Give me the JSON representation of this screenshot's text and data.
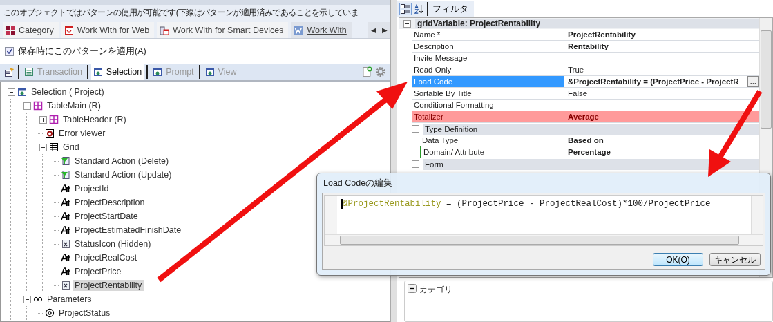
{
  "header": {
    "text": "このオブジェクトではパターンの使用が可能です(下線はパターンが適用済みであることを示していま"
  },
  "pattern_tabs": [
    {
      "label": "Category",
      "kind": "category",
      "selected": false
    },
    {
      "label": "Work With for Web",
      "kind": "web",
      "selected": false
    },
    {
      "label": "Work With for Smart Devices",
      "kind": "devices",
      "selected": false
    },
    {
      "label": "Work With",
      "kind": "workwith",
      "selected": true
    }
  ],
  "tab_scroll": [
    "◀",
    "▶"
  ],
  "apply_on_save": {
    "label": "保存時にこのパターンを適用(A)",
    "checked": true
  },
  "instance_tabs": [
    {
      "label": "Transaction",
      "kind": "transaction",
      "selected": false
    },
    {
      "label": "Selection",
      "kind": "page",
      "selected": true
    },
    {
      "label": "Prompt",
      "kind": "page",
      "selected": false
    },
    {
      "label": "View",
      "kind": "page",
      "selected": false
    }
  ],
  "tree": [
    {
      "label": "Selection ( Project)",
      "kind": "page",
      "expanded": true,
      "selected": false,
      "children": [
        {
          "label": "TableMain (R)",
          "kind": "table",
          "expanded": true,
          "selected": false,
          "children": [
            {
              "label": "TableHeader (R)",
              "kind": "table",
              "expanded": false,
              "selected": false
            },
            {
              "label": "Error viewer",
              "kind": "error",
              "selected": false
            },
            {
              "label": "Grid",
              "kind": "grid",
              "expanded": true,
              "selected": false,
              "children": [
                {
                  "label": "Standard Action (Delete)",
                  "kind": "action",
                  "selected": false
                },
                {
                  "label": "Standard Action (Update)",
                  "kind": "action",
                  "selected": false
                },
                {
                  "label": "ProjectId",
                  "kind": "attribute",
                  "selected": false
                },
                {
                  "label": "ProjectDescription",
                  "kind": "attribute",
                  "selected": false
                },
                {
                  "label": "ProjectStartDate",
                  "kind": "attribute",
                  "selected": false
                },
                {
                  "label": "ProjectEstimatedFinishDate",
                  "kind": "attribute",
                  "selected": false
                },
                {
                  "label": "StatusIcon (Hidden)",
                  "kind": "variable",
                  "selected": false
                },
                {
                  "label": "ProjectRealCost",
                  "kind": "attribute",
                  "selected": false
                },
                {
                  "label": "ProjectPrice",
                  "kind": "attribute",
                  "selected": false
                },
                {
                  "label": "ProjectRentability",
                  "kind": "variable",
                  "selected": true
                }
              ]
            }
          ]
        },
        {
          "label": "Parameters",
          "kind": "parameters",
          "expanded": true,
          "selected": false,
          "children": [
            {
              "label": "ProjectStatus",
              "kind": "parameter",
              "selected": false
            }
          ]
        }
      ]
    }
  ],
  "properties_toolbar": {
    "filter_label": "フィルタ"
  },
  "properties": {
    "title": "gridVariable: ProjectRentability",
    "expanded": true,
    "rows": [
      {
        "kind": "property",
        "name": "Name *",
        "value": "ProjectRentability",
        "modified": true,
        "selected": false,
        "highlighted": false
      },
      {
        "kind": "property",
        "name": "Description",
        "value": "Rentability",
        "modified": true,
        "selected": false,
        "highlighted": false
      },
      {
        "kind": "property",
        "name": "Invite Message",
        "selected": false,
        "highlighted": false
      },
      {
        "kind": "property",
        "name": "Read Only",
        "value": "True",
        "modified": false,
        "selected": false,
        "highlighted": false
      },
      {
        "kind": "property",
        "name": "Load Code",
        "value": "&ProjectRentability = (ProjectPrice - ProjectR",
        "modified": true,
        "selected": true,
        "highlighted": false,
        "button": "..."
      },
      {
        "kind": "property",
        "name": "Sortable By Title",
        "value": "False",
        "modified": false,
        "selected": false,
        "highlighted": false
      },
      {
        "kind": "property",
        "name": "Conditional Formatting",
        "selected": false,
        "highlighted": false
      },
      {
        "kind": "property",
        "name": "Totalizer",
        "value": "Average",
        "modified": true,
        "selected": false,
        "highlighted": true
      },
      {
        "kind": "group",
        "name": "Type Definition",
        "expanded": true,
        "children": [
          {
            "name": "Data Type",
            "value": "Based on",
            "modified": true,
            "flagged": false
          },
          {
            "name": "Domain/ Attribute",
            "value": "Percentage",
            "modified": true,
            "flagged": true
          }
        ]
      },
      {
        "kind": "group",
        "name": "Form",
        "expanded": true
      }
    ]
  },
  "category_panel": {
    "label": "カテゴリ",
    "expanded": true
  },
  "dialog": {
    "title": "Load Codeの編集",
    "code_variable": "&ProjectRentability",
    "code_rest": " = (ProjectPrice - ProjectRealCost)*100/ProjectPrice",
    "ok": "OK(O)",
    "cancel": "キャンセル"
  }
}
